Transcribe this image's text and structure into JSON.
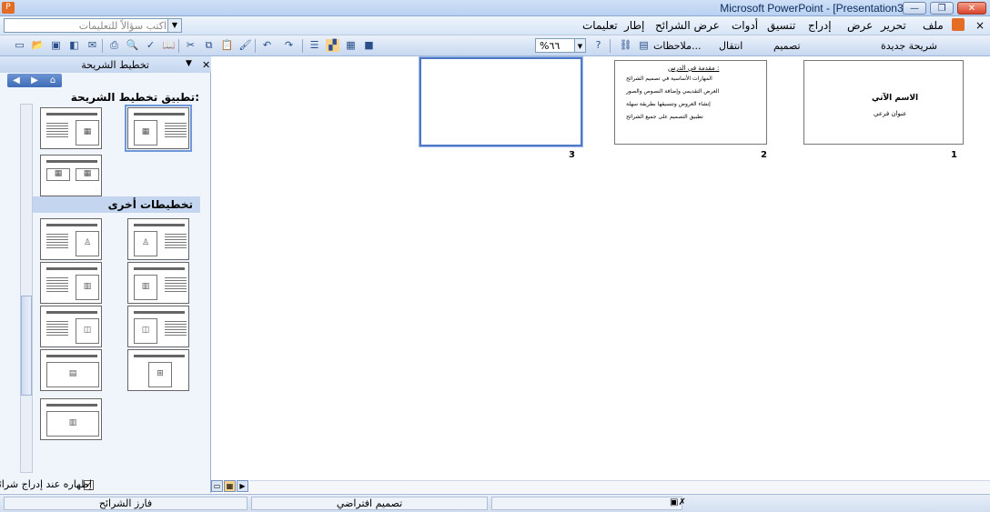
{
  "window": {
    "title": "Microsoft PowerPoint - [Presentation3]",
    "app_icon": "powerpoint-icon",
    "buttons": [
      "minimize",
      "restore",
      "close"
    ]
  },
  "menu": {
    "items": [
      "ملف",
      "تحرير",
      "عرض",
      "إدراج",
      "تنسيق",
      "أدوات",
      "عرض الشرائح",
      "إطار",
      "تعليمات"
    ],
    "help_placeholder": "اكتب سؤالاً للتعليمات"
  },
  "toolbar": {
    "new_slide": "شريحة جديدة",
    "design": "تصميم",
    "transition": "انتقال",
    "notes": "ملاحظات...",
    "zoom": "%٦٦"
  },
  "taskpane": {
    "title": "تخطيط الشريحة",
    "apply_heading": "تطبيق تخطيط الشريحة:",
    "other_heading": "تخطيطات أخرى",
    "show_on_insert": "إظهاره عند إدراج شرائح جديدة",
    "show_on_insert_checked": true
  },
  "slides": [
    {
      "number": "1",
      "title": "الاسم الآتي",
      "subtitle": "عنوان فرعي"
    },
    {
      "number": "2",
      "heading": "مقدمة في الدرس :",
      "bullets": [
        "المهارات الأساسية في تصميم الشرائح",
        "العرض التقديمي وإضافة النصوص والصور",
        "إنشاء العروض وتنسيقها بطريقة سهلة",
        "تطبيق التصميم على جميع الشرائح"
      ]
    },
    {
      "number": "3"
    }
  ],
  "statusbar": {
    "slide_sorter": "فارز الشرائح",
    "design": "تصميم افتراضي",
    "language_icon": "spellcheck-icon"
  },
  "colors": {
    "accent": "#4e79c7",
    "titlebar": "#c7daf3"
  }
}
